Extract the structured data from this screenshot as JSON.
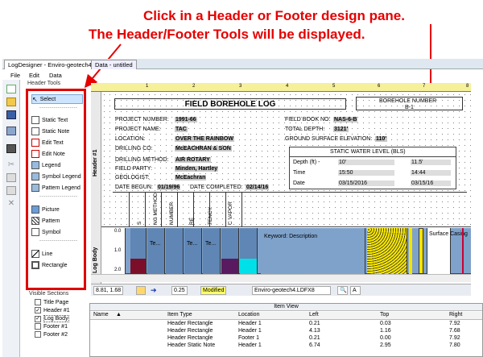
{
  "annotations": {
    "line1": "Click in a Header or Footer design pane.",
    "line2": "The Header/Footer Tools will be displayed."
  },
  "window_tabs": [
    {
      "label": "LogDesigner - Enviro-geotech4"
    },
    {
      "label": "Data - untitled"
    }
  ],
  "menu": {
    "file": "File",
    "edit": "Edit",
    "data": "Data"
  },
  "tools_panel": {
    "title": "Header Tools",
    "select": "Select",
    "separator": "-------------------",
    "items": [
      {
        "label": "Static Text"
      },
      {
        "label": "Static Note"
      },
      {
        "label": "Edit Text"
      },
      {
        "label": "Edit Note"
      },
      {
        "label": "Legend"
      },
      {
        "label": "Symbol Legend"
      },
      {
        "label": "Pattern Legend"
      },
      {
        "label": "Picture"
      },
      {
        "label": "Pattern"
      },
      {
        "label": "Symbol"
      },
      {
        "label": "Line"
      },
      {
        "label": "Rectangle"
      }
    ]
  },
  "visible_sections": {
    "title": "Visible Sections",
    "items": [
      {
        "label": "Title Page",
        "checked": false
      },
      {
        "label": "Header #1",
        "checked": true
      },
      {
        "label": "Log Body",
        "checked": true
      },
      {
        "label": "Footer #1",
        "checked": false
      },
      {
        "label": "Footer #2",
        "checked": false
      }
    ]
  },
  "ruler": {
    "ticks": [
      "1",
      "2",
      "3",
      "4",
      "5",
      "6",
      "7",
      "8"
    ]
  },
  "section_labels": {
    "header": "Header #1",
    "logbody": "Log Body"
  },
  "log_header": {
    "title": "FIELD BOREHOLE LOG",
    "borehole_number_label": "BOREHOLE NUMBER",
    "borehole_number": "B-1",
    "project_number_label": "PROJECT NUMBER:",
    "project_number": "1991-66",
    "project_name_label": "PROJECT NAME:",
    "project_name": "TAC",
    "location_label": "LOCATION:",
    "location": "OVER THE RAINBOW",
    "drilling_co_label": "DRILLING CO:",
    "drilling_co": "McEACHRAN & SON",
    "drilling_method_label": "DRILLING METHOD:",
    "drilling_method": "AIR ROTARY",
    "field_party_label": "FIELD PARTY:",
    "field_party": "Minden, Hartley",
    "geologist_label": "GEOLOGIST:",
    "geologist": "McEachran",
    "date_begun_label": "DATE BEGUN:",
    "date_begun": "01/19/96",
    "date_completed_label": "DATE COMPLETED:",
    "date_completed": "02/14/16",
    "field_book_label": "FIELD BOOK NO:",
    "field_book": "NAS-6-B",
    "total_depth_label": "TOTAL DEPTH:",
    "total_depth": "3121'",
    "ground_elev_label": "GROUND SURFACE ELEVATION:",
    "ground_elev": "110'",
    "swl": {
      "title": "STATIC WATER LEVEL (BLS)",
      "depth_label": "Depth (ft) -",
      "depth_1": "10'",
      "depth_2": "11.5'",
      "time_label": "Time",
      "time_1": "15:50",
      "time_2": "14:44",
      "date_label": "Date",
      "date_1": "03/15/2016",
      "date_2": "03/15/16"
    },
    "columns": [
      "S",
      "NG METHOD",
      "NUMBER",
      "RE",
      "TENCY",
      "C VAPOR"
    ]
  },
  "log_body": {
    "depth_ticks": [
      "0.0",
      "1.0",
      "2.0"
    ],
    "te_label": "Te...",
    "keyword": "Keyword: Description",
    "surface_casing": "Surface Casing"
  },
  "status_bar": {
    "coords": "8.81, 1.68",
    "zoom": "0.25",
    "modified": "Modified",
    "filename": "Enviro-geotech4.LDFX8"
  },
  "item_view": {
    "title": "Item View",
    "columns": [
      "Name",
      "Item Type",
      "Location",
      "Left",
      "Top",
      "Right"
    ],
    "rows": [
      {
        "type": "Header Rectangle",
        "location": "Header 1",
        "left": "0.21",
        "top": "0.03",
        "right": "7.92"
      },
      {
        "type": "Header Rectangle",
        "location": "Header 1",
        "left": "4.13",
        "top": "1.16",
        "right": "7.68"
      },
      {
        "type": "Header Rectangle",
        "location": "Footer 1",
        "left": "0.21",
        "top": "0.00",
        "right": "7.92"
      },
      {
        "type": "Header Static Note",
        "location": "Header 1",
        "left": "6.74",
        "top": "2.95",
        "right": "7.80"
      }
    ]
  },
  "colors": {
    "accent_red": "#e60000",
    "ruler_yellow": "#f6f09a",
    "logbody_blue": "#7fa2cb",
    "modified_yellow": "#ffff66"
  }
}
